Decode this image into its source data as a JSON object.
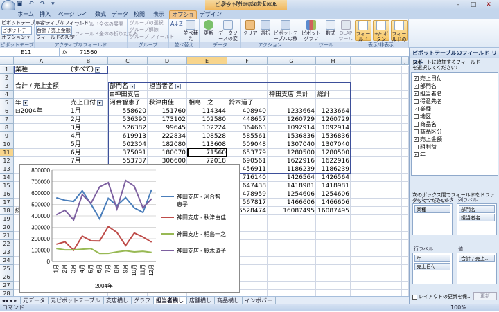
{
  "window": {
    "title": "3-4 - Microsoft Excel",
    "context_tab": "ピボットテーブル ツール",
    "quick_access": "▣ ↶ ↷ ▾"
  },
  "tabs": [
    "ホーム",
    "挿入",
    "ページ レイアウト",
    "数式",
    "データ",
    "校閲",
    "表示",
    "オプション",
    "デザイン"
  ],
  "ribbon": {
    "groups": [
      "ピボットテーブル",
      "アクティブなフィールド",
      "グループ",
      "並べ替え",
      "データ",
      "アクション",
      "ツール",
      "表示/非表示"
    ],
    "pivot_name_label": "ピボットテーブル名:",
    "pivot_name": "ピボットテーブル6",
    "options": "オプション ▾",
    "active_field_label": "アクティブなフィールド:",
    "active_field": "合計 / 売上金額",
    "field_settings": "フィールドの設定",
    "expand": "フィールド全体の展開",
    "collapse": "フィールド全体の折りたたみ",
    "grp_select": "グループの選択",
    "grp_ungroup": "グループ解除",
    "grp_field": "グループ フィールド",
    "sort": "並べ替え",
    "refresh": "更新",
    "change_source": "データソースの変更",
    "clear": "クリア",
    "select": "選択",
    "move": "ピボットテーブルの移動",
    "pivotchart": "ピボットグラフ",
    "formulas": "数式",
    "olap": "OLAP ツール",
    "field_list": "フィールド リスト",
    "buttons": "+/- ボタン",
    "headers": "フィールドの見出し"
  },
  "formula": {
    "cell": "E11",
    "fx": "fx",
    "value": "71560"
  },
  "columns": [
    "A",
    "B",
    "C",
    "D",
    "E",
    "F",
    "G",
    "H",
    "I",
    "J"
  ],
  "rows": [
    "1",
    "2",
    "3",
    "4",
    "5",
    "6",
    "7",
    "8",
    "9",
    "10",
    "11",
    "12",
    "13",
    "14",
    "15",
    "16",
    "17",
    "18",
    "19",
    "20",
    "21",
    "22",
    "23",
    "24",
    "25",
    "26",
    "27",
    "28",
    "29",
    "30"
  ],
  "pivot": {
    "filter_label": "業種",
    "filter_value": "(すべて)",
    "value_label": "合計 / 売上金額",
    "col_field1": "部門名",
    "col_field2": "担当者名",
    "dept": "⊟神田支店",
    "dept_total": "神田支店 集計",
    "grand_total": "総計",
    "persons": [
      "河合智恵子",
      "秋津由佳",
      "相島一之",
      "鈴木道子"
    ],
    "row_field1": "年",
    "row_field2": "売上日付",
    "year": "⊟2004年",
    "data": [
      [
        "1月",
        "558620",
        "151760",
        "114344",
        "408940",
        "1233664",
        "1233664"
      ],
      [
        "2月",
        "536390",
        "173102",
        "102580",
        "448657",
        "1260729",
        "1260729"
      ],
      [
        "3月",
        "526382",
        "99645",
        "102224",
        "364663",
        "1092914",
        "1092914"
      ],
      [
        "4月",
        "619913",
        "222834",
        "108528",
        "585561",
        "1536836",
        "1536836"
      ],
      [
        "5月",
        "502304",
        "182080",
        "113608",
        "509048",
        "1307040",
        "1307040"
      ],
      [
        "6月",
        "375091",
        "180070",
        "71560",
        "653779",
        "1280500",
        "1280500"
      ],
      [
        "7月",
        "553737",
        "306600",
        "72018",
        "690561",
        "1622916",
        "1622916"
      ]
    ],
    "partial_f": [
      "456911",
      "716140",
      "647438",
      "478959",
      "567817",
      "6528474"
    ],
    "partial_g": [
      "1186239",
      "1426564",
      "1418981",
      "1254606",
      "1466606",
      "16087495"
    ],
    "partial_h": [
      "1186239",
      "1426564",
      "1418981",
      "1254606",
      "1466606",
      "16087495"
    ],
    "row_total_stub": "総"
  },
  "chart_data": {
    "type": "line",
    "categories": [
      "1月",
      "2月",
      "3月",
      "4月",
      "5月",
      "6月",
      "7月",
      "8月",
      "9月",
      "10月",
      "11月",
      "12月"
    ],
    "xlabel": "2004年",
    "ylim": [
      0,
      800000
    ],
    "yticks": [
      "0",
      "100000",
      "200000",
      "300000",
      "400000",
      "500000",
      "600000",
      "700000",
      "800000"
    ],
    "series": [
      {
        "name": "神田支店 - 河合智恵子",
        "color": "#4a7ebb",
        "values": [
          558620,
          536390,
          526382,
          619913,
          502304,
          375091,
          553737,
          490000,
          560000,
          470000,
          430000,
          630000
        ]
      },
      {
        "name": "神田支店 - 秋津由佳",
        "color": "#be4b48",
        "values": [
          151760,
          173102,
          99645,
          222834,
          182080,
          180070,
          306600,
          255000,
          140000,
          250000,
          215000,
          170000
        ]
      },
      {
        "name": "神田支店 - 相島一之",
        "color": "#98b954",
        "values": [
          114344,
          102580,
          102224,
          108528,
          113608,
          71560,
          72018,
          85000,
          95000,
          85000,
          90000,
          80000
        ]
      },
      {
        "name": "神田支店 - 鈴木道子",
        "color": "#7d60a0",
        "values": [
          408940,
          448657,
          364663,
          585561,
          509048,
          653779,
          690561,
          460000,
          710000,
          660000,
          470000,
          550000
        ]
      }
    ],
    "legend": "right"
  },
  "sheet_tabs": [
    "元データ",
    "元ピボットテーブル",
    "支店横し",
    "グラフ",
    "担当者横し",
    "店舗横し",
    "商品横し",
    "インボバー"
  ],
  "active_sheet": "担当者横し",
  "status": "コマンド",
  "zoom": "100%",
  "panel": {
    "title": "ピボットテーブルのフィールド リスト",
    "instruction": "レポートに追加するフィールドを選択してください:",
    "fields": [
      {
        "label": "売上日付",
        "checked": "✓"
      },
      {
        "label": "部門名",
        "checked": "✓"
      },
      {
        "label": "担当者名",
        "checked": "✓"
      },
      {
        "label": "得意先名",
        "checked": ""
      },
      {
        "label": "業種",
        "checked": "✓"
      },
      {
        "label": "地区",
        "checked": ""
      },
      {
        "label": "商品名",
        "checked": ""
      },
      {
        "label": "商品区分",
        "checked": ""
      },
      {
        "label": "売上金額",
        "checked": "✓"
      },
      {
        "label": "粗利益",
        "checked": ""
      },
      {
        "label": "年",
        "checked": "✓"
      }
    ],
    "drag_text": "次のボックス間でフィールドをドラッグしてください:",
    "area_filter": "レポート フィルタ",
    "area_cols": "列ラベル",
    "area_rows": "行ラベル",
    "area_values": "値",
    "filter_items": [
      "業種"
    ],
    "col_items": [
      "部門名",
      "担当者名"
    ],
    "row_items": [
      "年",
      "売上日付"
    ],
    "value_items": [
      "合計 / 売上..."
    ],
    "defer": "レイアウトの更新を保...",
    "update": "更新"
  }
}
